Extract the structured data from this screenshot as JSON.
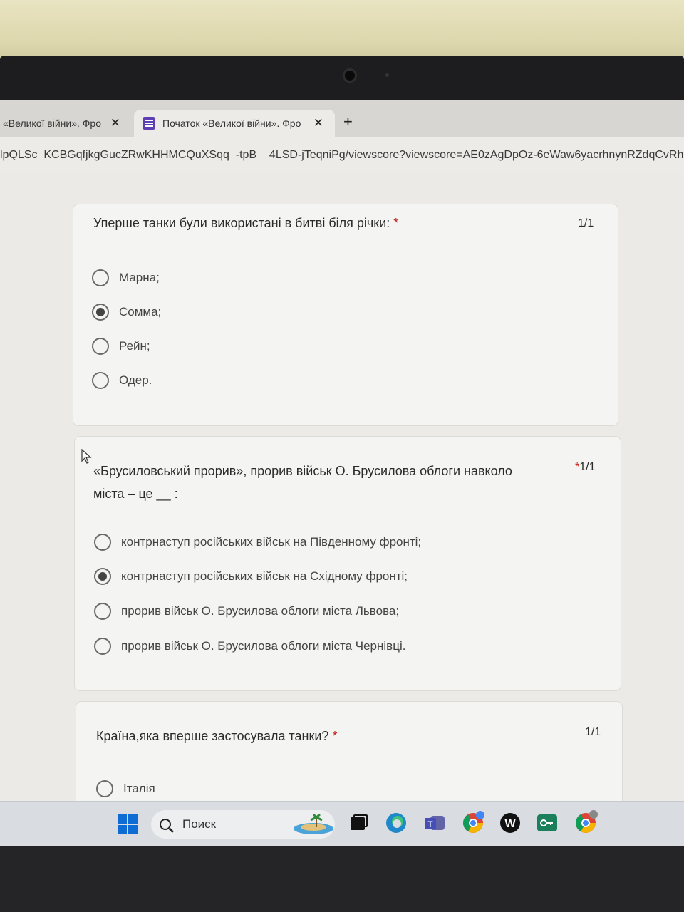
{
  "browser": {
    "tabs": [
      {
        "title": "«Великої війни». Фро",
        "close": "✕"
      },
      {
        "title": "Початок «Великої війни». Фро",
        "close": "✕"
      }
    ],
    "new_tab": "+",
    "url": "lpQLSc_KCBGqfjkgGucZRwKHHMCQuXSqq_-tpB__4LSD-jTeqniPg/viewscore?viewscore=AE0zAgDpOz-6eWaw6yacrhnynRZdqCvRh"
  },
  "questions": [
    {
      "title": "Уперше танки були використані в битві біля річки:",
      "required": "*",
      "score": "1/1",
      "options": [
        {
          "label": "Марна;",
          "checked": false
        },
        {
          "label": "Сомма;",
          "checked": true
        },
        {
          "label": "Рейн;",
          "checked": false
        },
        {
          "label": "Одер.",
          "checked": false
        }
      ]
    },
    {
      "title_line1": "«Брусиловський прорив», прорив військ О. Брусилова облоги навколо",
      "title_line2": "міста – це __ :",
      "required": "*",
      "score": "1/1",
      "options": [
        {
          "label": "контрнаступ російських військ на Південному фронті;",
          "checked": false
        },
        {
          "label": "контрнаступ російських військ на Східному фронті;",
          "checked": true
        },
        {
          "label": "прорив військ О. Брусилова облоги міста Львова;",
          "checked": false
        },
        {
          "label": "прорив військ О. Брусилова облоги міста Чернівці.",
          "checked": false
        }
      ]
    },
    {
      "title": "Країна,яка вперше застосувала танки?",
      "required": "*",
      "score": "1/1",
      "options": [
        {
          "label": "Італія",
          "checked": false
        }
      ]
    }
  ],
  "taskbar": {
    "search_label": "Поиск",
    "icons": [
      "windows-start-icon",
      "search-icon",
      "island-widget-icon",
      "task-view-icon",
      "edge-icon",
      "teams-icon",
      "chrome-profile-icon",
      "w-app-icon",
      "key-app-icon",
      "chrome-icon"
    ]
  }
}
